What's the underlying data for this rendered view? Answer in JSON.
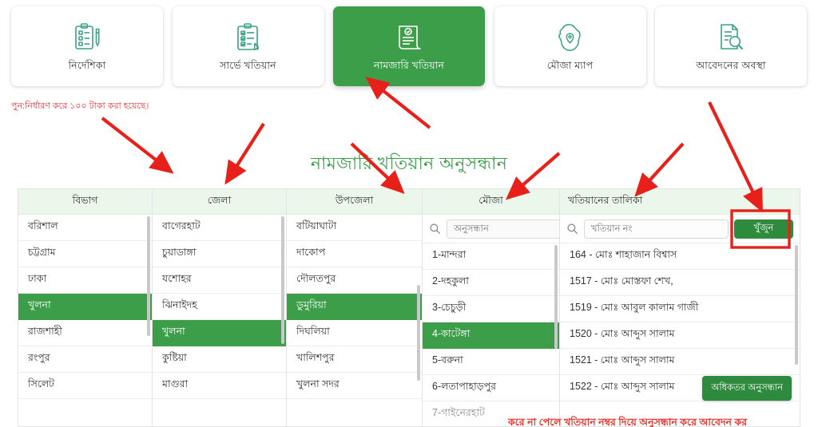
{
  "tabs": [
    {
      "label": "নির্দেশিকা",
      "icon": "clipboard-pen-icon",
      "active": false
    },
    {
      "label": "সার্ভে খতিয়ান",
      "icon": "clipboard-check-icon",
      "active": false
    },
    {
      "label": "নামজারি খতিয়ান",
      "icon": "certificate-icon",
      "active": true
    },
    {
      "label": "মৌজা ম্যাপ",
      "icon": "map-pin-icon",
      "active": false
    },
    {
      "label": "আবেদনের অবস্থা",
      "icon": "document-search-icon",
      "active": false
    }
  ],
  "notices": {
    "top": "পুন:নির্ধারণ করে ১০০ টাকা করা হয়েছে।",
    "bottom": "করে না পেলে খতিয়ান নম্বর দিয়ে অনুসন্ধান করে আবেদন কর"
  },
  "page": {
    "title": "নামজারি খতিয়ান অনুসন্ধান"
  },
  "columns": {
    "division": {
      "header": "বিভাগ",
      "items": [
        {
          "label": "বরিশাল",
          "selected": false
        },
        {
          "label": "চট্টগ্রাম",
          "selected": false
        },
        {
          "label": "ঢাকা",
          "selected": false
        },
        {
          "label": "খুলনা",
          "selected": true
        },
        {
          "label": "রাজশাহী",
          "selected": false
        },
        {
          "label": "রংপুর",
          "selected": false
        },
        {
          "label": "সিলেট",
          "selected": false
        }
      ]
    },
    "district": {
      "header": "জেলা",
      "items": [
        {
          "label": "বাগেরহাট",
          "selected": false
        },
        {
          "label": "চুয়াডাঙ্গা",
          "selected": false
        },
        {
          "label": "যশোহর",
          "selected": false
        },
        {
          "label": "ঝিনাইদহ",
          "selected": false
        },
        {
          "label": "খুলনা",
          "selected": true
        },
        {
          "label": "কুষ্টিয়া",
          "selected": false
        },
        {
          "label": "মাগুরা",
          "selected": false
        }
      ]
    },
    "upazila": {
      "header": "উপজেলা",
      "items": [
        {
          "label": "বটিয়াঘাটা",
          "selected": false
        },
        {
          "label": "দাকোপ",
          "selected": false
        },
        {
          "label": "দৌলতপুর",
          "selected": false
        },
        {
          "label": "ডুমুরিয়া",
          "selected": true
        },
        {
          "label": "দিঘলিয়া",
          "selected": false
        },
        {
          "label": "খালিশপুর",
          "selected": false
        },
        {
          "label": "খুলনা সদর",
          "selected": false
        }
      ]
    },
    "mouza": {
      "header": "মৌজা",
      "search_placeholder": "অনুসন্ধান",
      "search_value": "",
      "items": [
        {
          "label": "1-মান্দরা",
          "selected": false
        },
        {
          "label": "2-দহকুলা",
          "selected": false
        },
        {
          "label": "3-চেচুড়ী",
          "selected": false
        },
        {
          "label": "4-কাটেঙ্গা",
          "selected": true
        },
        {
          "label": "5-বরুনা",
          "selected": false
        },
        {
          "label": "6-লতাপাহাড়পুর",
          "selected": false
        },
        {
          "label": "7-গাইনেরহাট",
          "selected": false
        }
      ]
    },
    "khatian": {
      "header": "খতিয়ানের তালিকা",
      "search_placeholder": "খতিয়ান নং",
      "search_value": "",
      "find_button": "খুঁজুন",
      "more_button": "অধিকতর অনুসন্ধান",
      "items": [
        {
          "label": "164 - মোঃ শাহাজান বিশ্বাস",
          "selected": false
        },
        {
          "label": "1517 - মোঃ মোস্তফা শেখ,",
          "selected": false
        },
        {
          "label": "1519 - মোঃ আবুল কালাম গাজী",
          "selected": false
        },
        {
          "label": "1520 - মোঃ আব্দুস সালাম",
          "selected": false
        },
        {
          "label": "1521 - মোঃ আব্দুস সালাম",
          "selected": false
        },
        {
          "label": "1522 - মোঃ আব্দুস সালাম",
          "selected": false
        }
      ]
    }
  },
  "colors": {
    "brand_green": "#3d9e4a",
    "button_green": "#2e8b3d",
    "icon_teal": "#3aa088",
    "header_bg": "#eaf7ea",
    "annotation_red": "#e8201a",
    "notice_red": "#e8342c"
  }
}
